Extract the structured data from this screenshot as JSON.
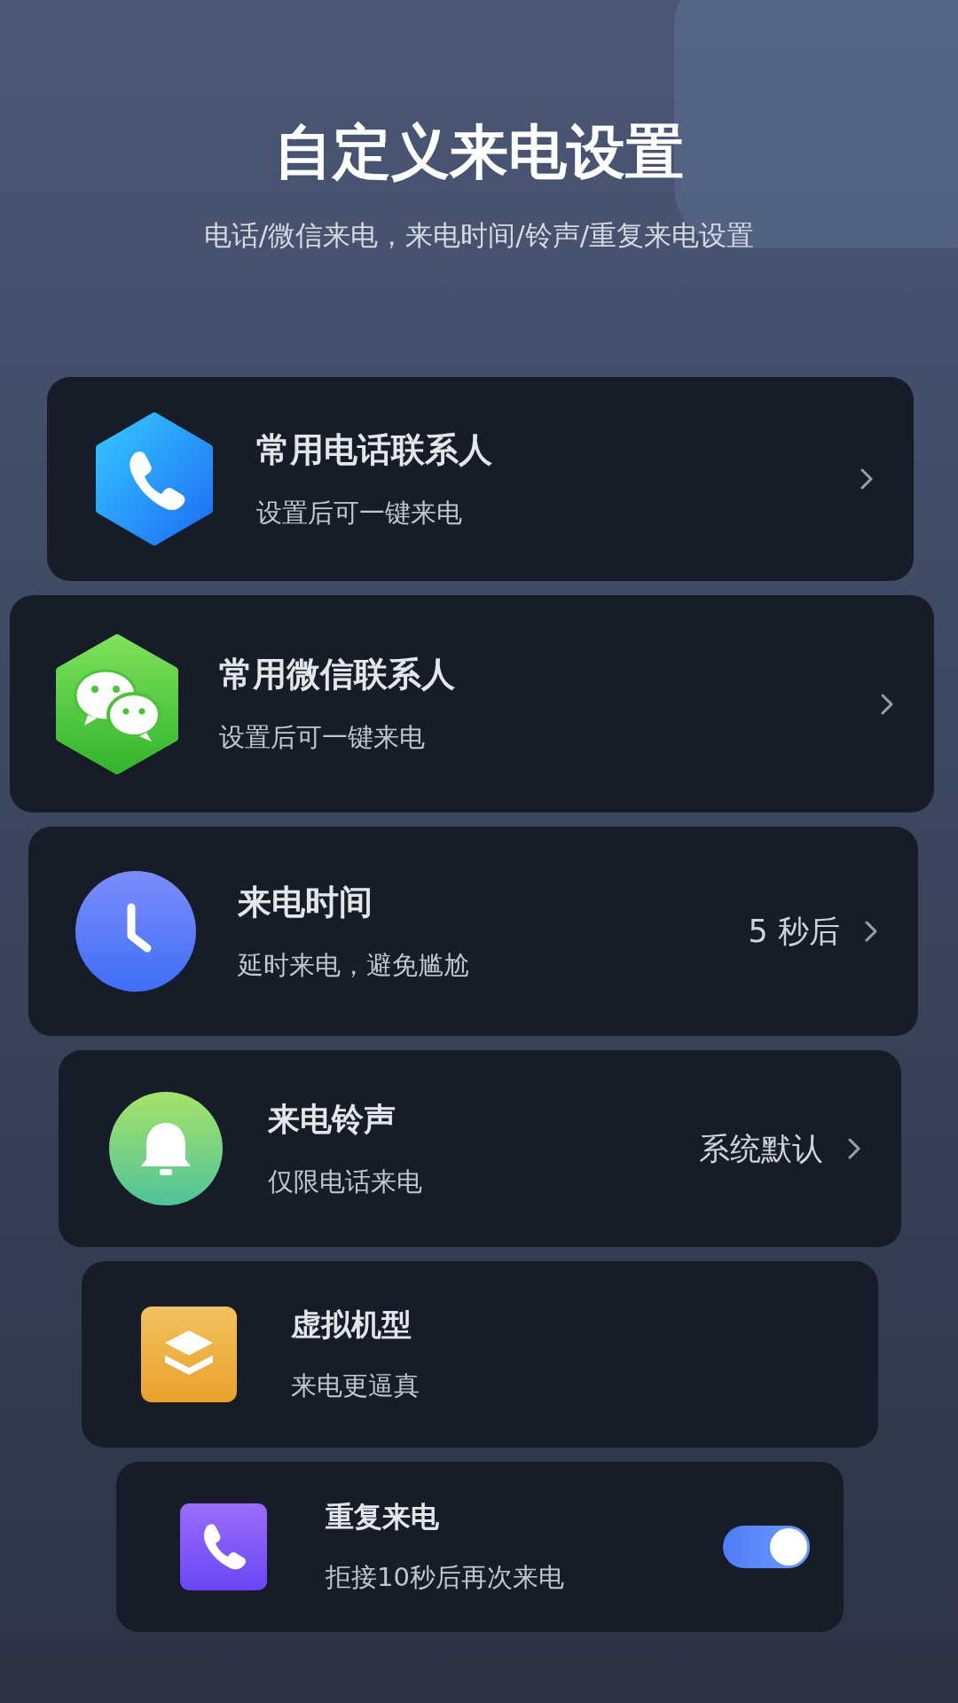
{
  "header": {
    "title": "自定义来电设置",
    "subtitle": "电话/微信来电，来电时间/铃声/重复来电设置"
  },
  "items": [
    {
      "title": "常用电话联系人",
      "subtitle": "设置后可一键来电",
      "kind": "chevron"
    },
    {
      "title": "常用微信联系人",
      "subtitle": "设置后可一键来电",
      "kind": "chevron"
    },
    {
      "title": "来电时间",
      "subtitle": "延时来电，避免尴尬",
      "value": "5 秒后",
      "kind": "chevron"
    },
    {
      "title": "来电铃声",
      "subtitle": "仅限电话来电",
      "value": "系统默认",
      "kind": "chevron"
    },
    {
      "title": "虚拟机型",
      "subtitle": "来电更逼真",
      "kind": "none"
    },
    {
      "title": "重复来电",
      "subtitle": "拒接10秒后再次来电",
      "kind": "toggle",
      "on": true
    }
  ]
}
